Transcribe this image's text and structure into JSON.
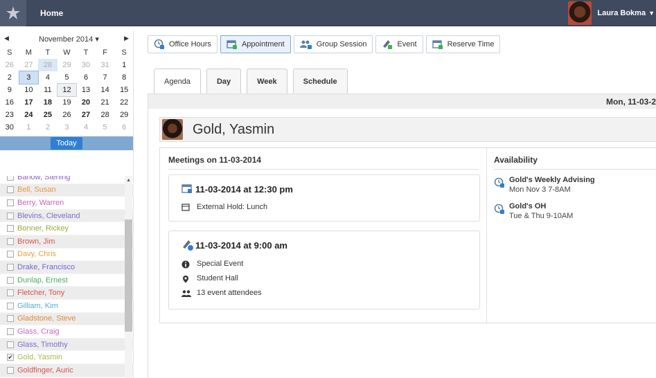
{
  "topbar": {
    "home_label": "Home",
    "user_name": "Laura Bokma"
  },
  "calendar": {
    "month_label": "November 2014 ▾",
    "weekdays": [
      "S",
      "M",
      "T",
      "W",
      "T",
      "F",
      "S"
    ],
    "weeks": [
      [
        "26",
        "27",
        "28",
        "29",
        "30",
        "31",
        "1"
      ],
      [
        "2",
        "3",
        "4",
        "5",
        "6",
        "7",
        "8"
      ],
      [
        "9",
        "10",
        "11",
        "12",
        "13",
        "14",
        "15"
      ],
      [
        "16",
        "17",
        "18",
        "19",
        "20",
        "21",
        "22"
      ],
      [
        "23",
        "24",
        "25",
        "26",
        "27",
        "28",
        "29"
      ],
      [
        "30",
        "1",
        "2",
        "3",
        "4",
        "5",
        "6"
      ]
    ],
    "today_label": "Today"
  },
  "people_list": [
    {
      "name": "Barlow, Sterling",
      "color": "#8b5fbf",
      "checked": false
    },
    {
      "name": "Bell, Susan",
      "color": "#e69a3c",
      "checked": false
    },
    {
      "name": "Berry, Warren",
      "color": "#c864b4",
      "checked": false
    },
    {
      "name": "Blevins, Cleveland",
      "color": "#7b70c9",
      "checked": false
    },
    {
      "name": "Bonner, Rickey",
      "color": "#9aaa3a",
      "checked": false
    },
    {
      "name": "Brown, Jim",
      "color": "#d9534f",
      "checked": false
    },
    {
      "name": "Davy, Chris",
      "color": "#e8a23a",
      "checked": false
    },
    {
      "name": "Drake, Francisco",
      "color": "#6f68d2",
      "checked": false
    },
    {
      "name": "Dunlap, Ernest",
      "color": "#4daa5a",
      "checked": false
    },
    {
      "name": "Fletcher, Tony",
      "color": "#d9534f",
      "checked": false
    },
    {
      "name": "Gilliam, Kim",
      "color": "#5aa9d8",
      "checked": false
    },
    {
      "name": "Gladstone, Steve",
      "color": "#e08a3c",
      "checked": false
    },
    {
      "name": "Glass, Craig",
      "color": "#c864c8",
      "checked": false
    },
    {
      "name": "Glass, Timothy",
      "color": "#7b70c9",
      "checked": false
    },
    {
      "name": "Gold, Yasmin",
      "color": "#a8b84a",
      "checked": true
    },
    {
      "name": "Goldfinger, Auric",
      "color": "#d9534f",
      "checked": false
    }
  ],
  "toolbar": [
    {
      "label": "Office Hours",
      "icon": "office-hours-icon",
      "active": false
    },
    {
      "label": "Appointment",
      "icon": "appointment-icon",
      "active": true
    },
    {
      "label": "Group Session",
      "icon": "group-session-icon",
      "active": false
    },
    {
      "label": "Event",
      "icon": "event-icon",
      "active": false
    },
    {
      "label": "Reserve Time",
      "icon": "reserve-time-icon",
      "active": false
    }
  ],
  "tabs": [
    {
      "label": "Agenda",
      "active": true
    },
    {
      "label": "Day",
      "active": false
    },
    {
      "label": "Week",
      "active": false
    },
    {
      "label": "Schedule",
      "active": false
    }
  ],
  "date_bar": "Mon, 11-03-2",
  "profile": {
    "name": "Gold, Yasmin"
  },
  "meetings": {
    "title": "Meetings on 11-03-2014",
    "items": [
      {
        "time": "11-03-2014 at 12:30 pm",
        "rows": [
          {
            "icon": "calendar-icon",
            "text": "External Hold: Lunch"
          }
        ]
      },
      {
        "time": "11-03-2014 at 9:00 am",
        "rows": [
          {
            "icon": "info-icon",
            "text": "Special Event"
          },
          {
            "icon": "location-pin-icon",
            "text": "Student Hall"
          },
          {
            "icon": "people-icon",
            "text": "13 event attendees"
          }
        ]
      }
    ]
  },
  "availability": {
    "title": "Availability",
    "items": [
      {
        "name": "Gold's Weekly Advising",
        "when": "Mon Nov 3 7-8AM"
      },
      {
        "name": "Gold's OH",
        "when": "Tue & Thu 9-10AM"
      }
    ]
  },
  "colors": {
    "topbar": "#3f4a5f",
    "accent": "#2f7fd2",
    "today_bar": "#7ea8d2"
  }
}
